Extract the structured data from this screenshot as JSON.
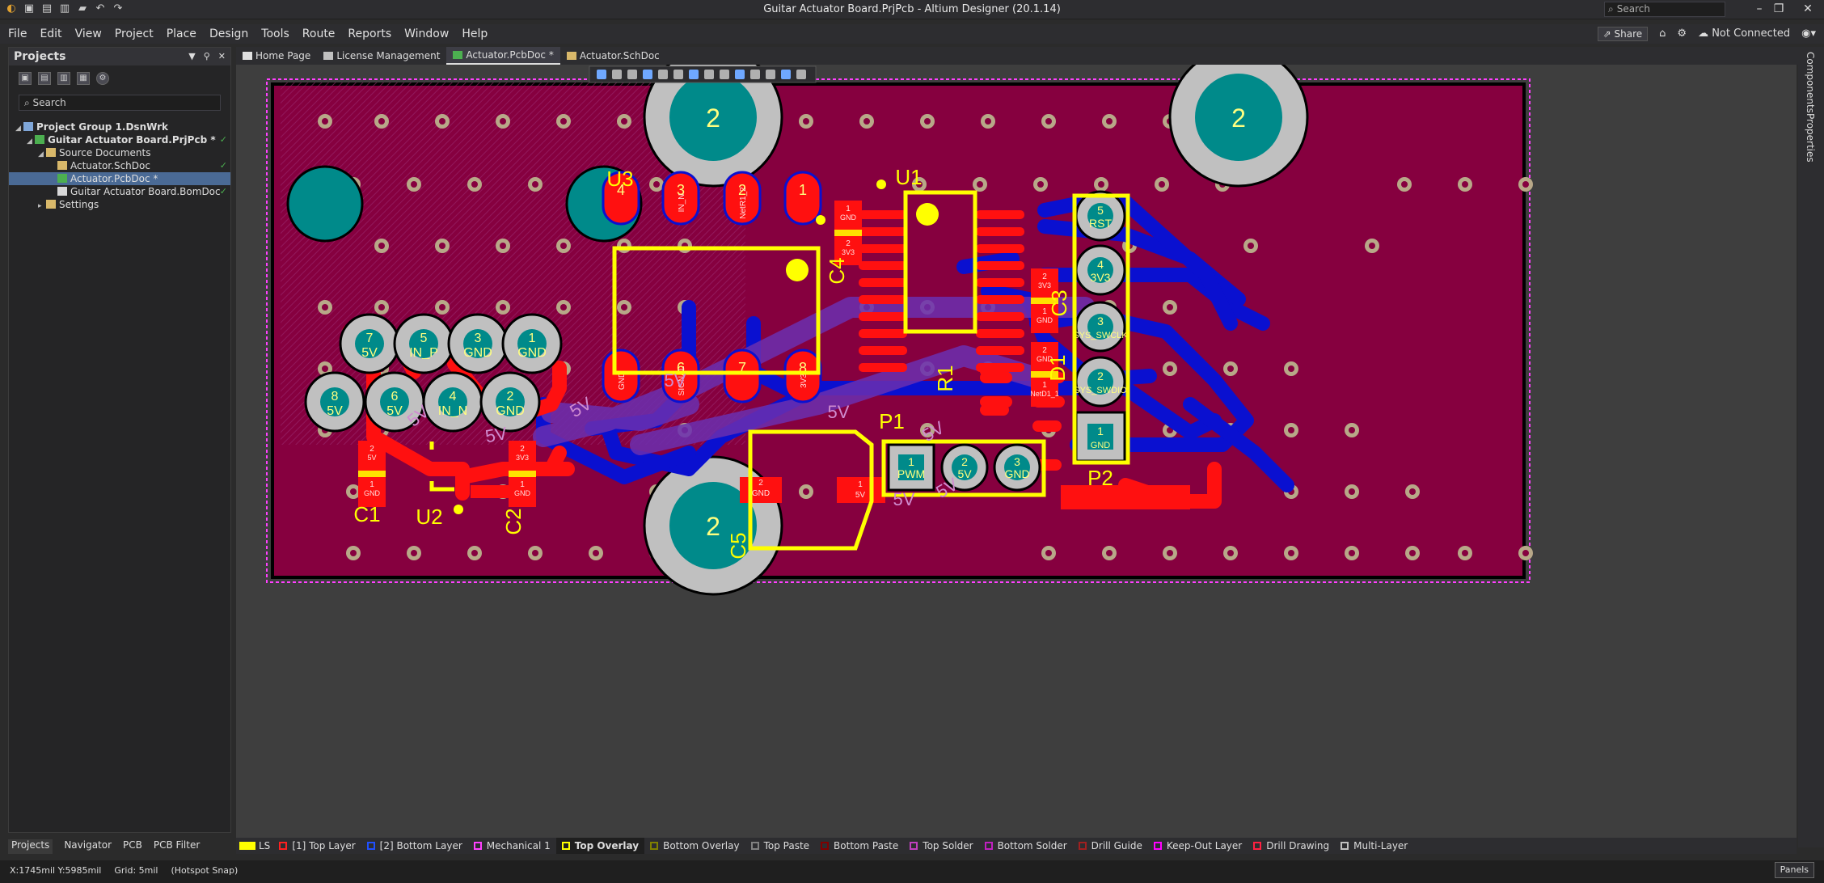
{
  "window": {
    "title": "Guitar Actuator Board.PrjPcb - Altium Designer (20.1.14)",
    "search_placeholder": "Search"
  },
  "menu": {
    "items": [
      "File",
      "Edit",
      "View",
      "Project",
      "Place",
      "Design",
      "Tools",
      "Route",
      "Reports",
      "Window",
      "Help"
    ],
    "share": "Share",
    "connection": "Not Connected"
  },
  "projects": {
    "title": "Projects",
    "search": "Search",
    "tree": [
      {
        "label": "Project Group 1.DsnWrk",
        "indent": 0,
        "bold": true,
        "icon": "#7fa6d8"
      },
      {
        "label": "Guitar Actuator Board.PrjPcb *",
        "indent": 1,
        "bold": true,
        "icon": "#4caf50",
        "stat": "✓"
      },
      {
        "label": "Source Documents",
        "indent": 2,
        "icon": "#d8b86a"
      },
      {
        "label": "Actuator.SchDoc",
        "indent": 3,
        "icon": "#d8b86a",
        "stat": "✓"
      },
      {
        "label": "Actuator.PcbDoc *",
        "indent": 3,
        "icon": "#4caf50",
        "sel": true
      },
      {
        "label": "Guitar Actuator Board.BomDoc",
        "indent": 3,
        "icon": "#d8d8d8",
        "stat": "✓"
      },
      {
        "label": "Settings",
        "indent": 2,
        "icon": "#d8b86a"
      }
    ]
  },
  "panel_tabs": [
    "Projects",
    "Navigator",
    "PCB",
    "PCB Filter"
  ],
  "doc_tabs": [
    {
      "label": "Home Page",
      "icon": "home"
    },
    {
      "label": "License Management",
      "icon": "key"
    },
    {
      "label": "Actuator.PcbDoc *",
      "icon": "pcb",
      "active": true
    },
    {
      "label": "Actuator.SchDoc",
      "icon": "sch"
    }
  ],
  "right_panels": [
    "Components",
    "Properties"
  ],
  "layers": [
    {
      "label": "LS",
      "color": "#ffff00"
    },
    {
      "label": "[1] Top Layer",
      "color": "#ff2020"
    },
    {
      "label": "[2] Bottom Layer",
      "color": "#2050ff"
    },
    {
      "label": "Mechanical 1",
      "color": "#ff40ff"
    },
    {
      "label": "Top Overlay",
      "color": "#ffff00",
      "active": true
    },
    {
      "label": "Bottom Overlay",
      "color": "#808000"
    },
    {
      "label": "Top Paste",
      "color": "#808080"
    },
    {
      "label": "Bottom Paste",
      "color": "#800000"
    },
    {
      "label": "Top Solder",
      "color": "#c040c0"
    },
    {
      "label": "Bottom Solder",
      "color": "#c020c0"
    },
    {
      "label": "Drill Guide",
      "color": "#a02020"
    },
    {
      "label": "Keep-Out Layer",
      "color": "#ff00ff"
    },
    {
      "label": "Drill Drawing",
      "color": "#ff2040"
    },
    {
      "label": "Multi-Layer",
      "color": "#c0c0c0"
    }
  ],
  "status": {
    "coords": "X:1745mil Y:5985mil",
    "grid": "Grid: 5mil",
    "snap": "(Hotspot Snap)",
    "panels": "Panels"
  },
  "pcb": {
    "designators": [
      "U3",
      "U1",
      "C4",
      "C3",
      "R1",
      "D1",
      "P1",
      "P2",
      "C1",
      "U2",
      "C2",
      "C5"
    ],
    "mount_label": "2",
    "u3_pads": [
      {
        "num": "4",
        "net": ""
      },
      {
        "num": "3",
        "net": "IN_N"
      },
      {
        "num": "2",
        "net": "NetR1_2"
      },
      {
        "num": "1",
        "net": ""
      },
      {
        "num": "",
        "net": "GND"
      },
      {
        "num": "6",
        "net": "SIGNAL"
      },
      {
        "num": "7",
        "net": ""
      },
      {
        "num": "8",
        "net": "3V3"
      }
    ],
    "thru_pads": [
      {
        "num": "7",
        "net": "5V"
      },
      {
        "num": "5",
        "net": "IN_P"
      },
      {
        "num": "3",
        "net": "GND"
      },
      {
        "num": "1",
        "net": "GND"
      },
      {
        "num": "8",
        "net": "5V"
      },
      {
        "num": "6",
        "net": "5V"
      },
      {
        "num": "4",
        "net": "IN_N"
      },
      {
        "num": "2",
        "net": "GND"
      }
    ],
    "p2_pads": [
      {
        "num": "5",
        "net": "RST"
      },
      {
        "num": "4",
        "net": "3V3"
      },
      {
        "num": "3",
        "net": "SYS_SWCLK"
      },
      {
        "num": "2",
        "net": "SYS_SWDIO"
      },
      {
        "num": "1",
        "net": "GND"
      }
    ],
    "p1_pads": [
      {
        "num": "1",
        "net": "PWM"
      },
      {
        "num": "2",
        "net": "5V"
      },
      {
        "num": "3",
        "net": "GND"
      }
    ],
    "smd": {
      "c4": [
        {
          "num": "1",
          "net": "GND"
        },
        {
          "num": "2",
          "net": "3V3"
        }
      ],
      "c3": [
        {
          "num": "2",
          "net": "3V3"
        },
        {
          "num": "1",
          "net": "GND"
        }
      ],
      "d1": [
        {
          "num": "2",
          "net": "GND"
        },
        {
          "num": "1",
          "net": "NetD1_1"
        }
      ],
      "c1": [
        {
          "num": "2",
          "net": "5V"
        },
        {
          "num": "1",
          "net": "GND"
        }
      ],
      "c2": [
        {
          "num": "2",
          "net": "3V3"
        },
        {
          "num": "1",
          "net": "GND"
        }
      ],
      "c5": [
        {
          "num": "2",
          "net": "GND"
        },
        {
          "num": "1",
          "net": "5V"
        }
      ]
    },
    "net_labels": [
      "5V",
      "5V",
      "5V",
      "5V",
      "5V",
      "5V",
      "5V",
      "5V"
    ]
  }
}
